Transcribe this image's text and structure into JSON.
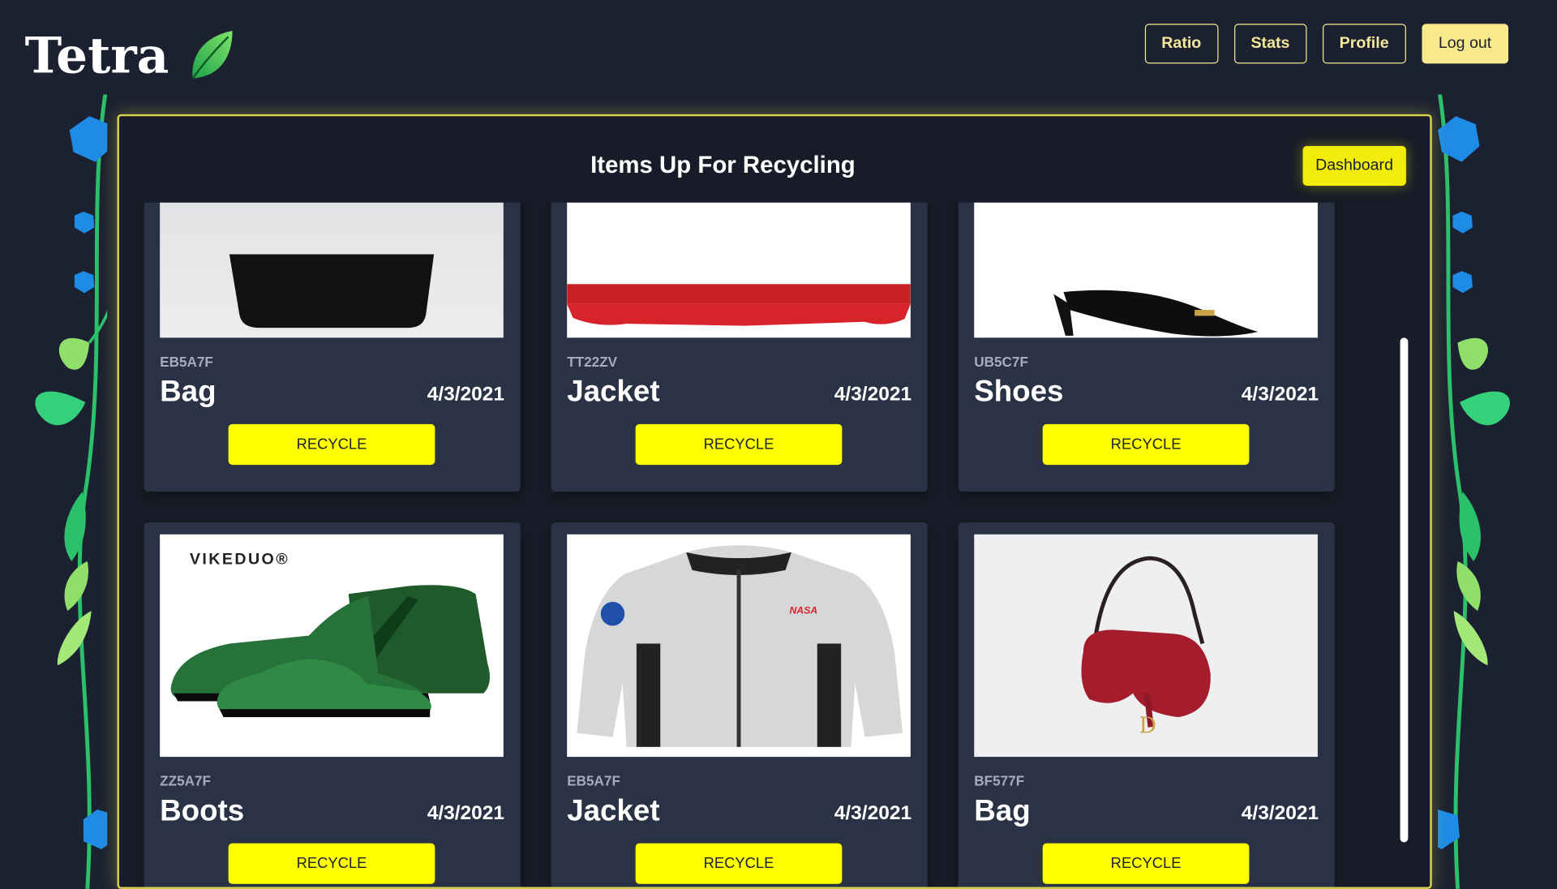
{
  "brand": {
    "name": "Tetra"
  },
  "nav": {
    "ratio": "Ratio",
    "stats": "Stats",
    "profile": "Profile",
    "logout": "Log out"
  },
  "panel": {
    "title": "Items Up For Recycling",
    "dashboard": "Dashboard"
  },
  "items": [
    {
      "code": "EB5A7F",
      "name": "Bag",
      "date": "4/3/2021",
      "action": "RECYCLE",
      "image": "bag-black"
    },
    {
      "code": "TT22ZV",
      "name": "Jacket",
      "date": "4/3/2021",
      "action": "RECYCLE",
      "image": "jacket-red"
    },
    {
      "code": "UB5C7F",
      "name": "Shoes",
      "date": "4/3/2021",
      "action": "RECYCLE",
      "image": "heels-black"
    },
    {
      "code": "ZZ5A7F",
      "name": "Boots",
      "date": "4/3/2021",
      "action": "RECYCLE",
      "image": "boots-green",
      "image_text": "VIKEDUO®"
    },
    {
      "code": "EB5A7F",
      "name": "Jacket",
      "date": "4/3/2021",
      "action": "RECYCLE",
      "image": "jacket-nasa",
      "image_text": "NASA"
    },
    {
      "code": "BF577F",
      "name": "Bag",
      "date": "4/3/2021",
      "action": "RECYCLE",
      "image": "saddle-bag-red",
      "image_text": "D"
    }
  ],
  "colors": {
    "background": "#1b2130",
    "accent": "#ffff00",
    "panel_border": "#d9d44a",
    "card": "#2a3245",
    "nav_outline": "#f5e89a"
  }
}
